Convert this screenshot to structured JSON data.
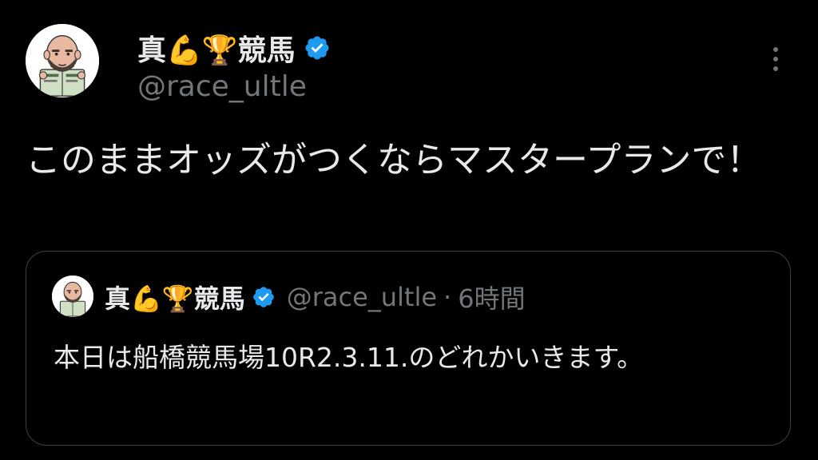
{
  "tweet": {
    "author": {
      "display_name": "真💪🏆競馬",
      "handle": "@race_ultle",
      "verified_icon": "verified-badge-icon",
      "avatar_icon": "avatar-bald-man-reading-newspaper"
    },
    "text": "このままオッズがつくならマスタープランで！",
    "more_icon": "more-options-icon"
  },
  "quoted_tweet": {
    "author": {
      "display_name": "真💪🏆競馬",
      "handle": "@race_ultle"
    },
    "separator": "·",
    "time": "6時間",
    "text": "本日は船橋競馬場10R2.3.11.のどれかいきます。"
  },
  "colors": {
    "background": "#000000",
    "primary_text": "#e7e9ea",
    "secondary_text": "#71767b",
    "verified_blue": "#1d9bf0",
    "card_border": "#3e4144"
  }
}
